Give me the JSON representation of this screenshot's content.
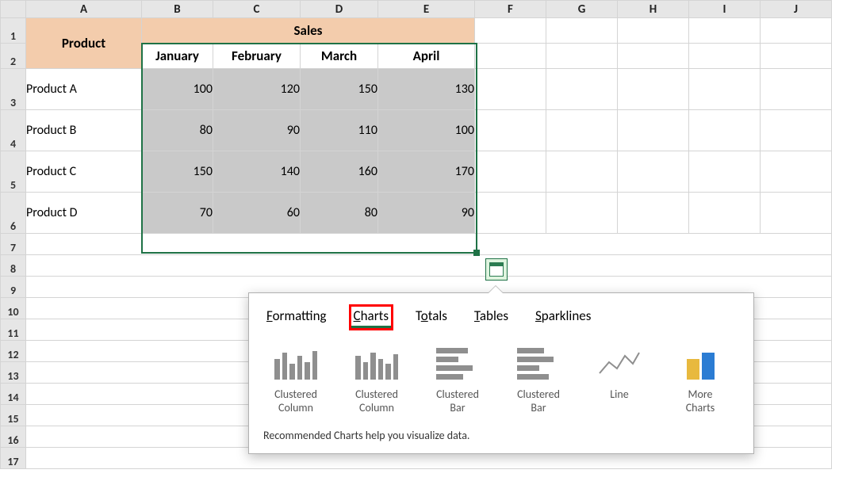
{
  "colHeaders": [
    "A",
    "B",
    "C",
    "D",
    "E",
    "F",
    "G",
    "H",
    "I",
    "J"
  ],
  "rowHeaders": [
    "1",
    "2",
    "3",
    "4",
    "5",
    "6",
    "7",
    "8",
    "9",
    "10",
    "11",
    "12",
    "13",
    "14",
    "15",
    "16",
    "17"
  ],
  "table": {
    "productHeader": "Product",
    "salesHeader": "Sales",
    "months": [
      "January",
      "February",
      "March",
      "April"
    ],
    "rows": [
      {
        "name": "Product A",
        "vals": [
          "100",
          "120",
          "150",
          "130"
        ]
      },
      {
        "name": "Product B",
        "vals": [
          "80",
          "90",
          "110",
          "100"
        ]
      },
      {
        "name": "Product C",
        "vals": [
          "150",
          "140",
          "160",
          "170"
        ]
      },
      {
        "name": "Product D",
        "vals": [
          "70",
          "60",
          "80",
          "90"
        ]
      }
    ]
  },
  "quickAnalysis": {
    "tabs": [
      {
        "label": "Formatting",
        "accel": "F"
      },
      {
        "label": "Charts",
        "accel": "C"
      },
      {
        "label": "Totals",
        "accel": "o"
      },
      {
        "label": "Tables",
        "accel": "T"
      },
      {
        "label": "Sparklines",
        "accel": "S"
      }
    ],
    "activeTab": 1,
    "options": [
      {
        "label_l1": "Clustered",
        "label_l2": "Column",
        "type": "col"
      },
      {
        "label_l1": "Clustered",
        "label_l2": "Column",
        "type": "col"
      },
      {
        "label_l1": "Clustered",
        "label_l2": "Bar",
        "type": "bar"
      },
      {
        "label_l1": "Clustered",
        "label_l2": "Bar",
        "type": "bar"
      },
      {
        "label_l1": "Line",
        "label_l2": "",
        "type": "line"
      },
      {
        "label_l1": "More",
        "label_l2": "Charts",
        "type": "more"
      }
    ],
    "hint": "Recommended Charts help you visualize data."
  },
  "chart_data": {
    "type": "table",
    "title": "Sales",
    "columns": [
      "Product",
      "January",
      "February",
      "March",
      "April"
    ],
    "rows": [
      [
        "Product A",
        100,
        120,
        150,
        130
      ],
      [
        "Product B",
        80,
        90,
        110,
        100
      ],
      [
        "Product C",
        150,
        140,
        160,
        170
      ],
      [
        "Product D",
        70,
        60,
        80,
        90
      ]
    ]
  }
}
